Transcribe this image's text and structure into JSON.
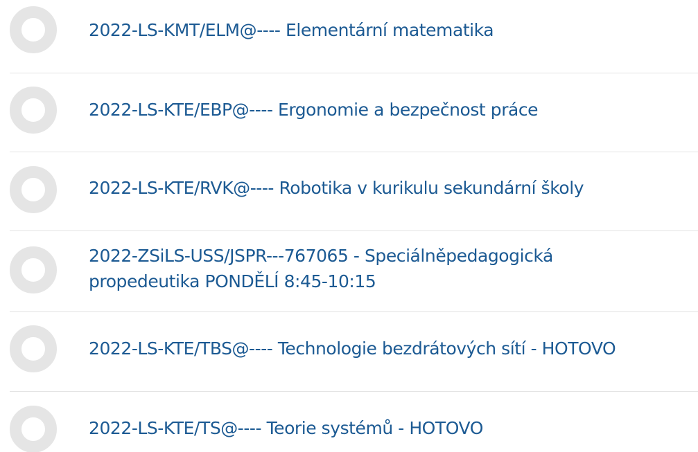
{
  "courses": [
    {
      "label": "2022-LS-KMT/ELM@---- Elementární matematika"
    },
    {
      "label": "2022-LS-KTE/EBP@---- Ergonomie a bezpečnost práce"
    },
    {
      "label": "2022-LS-KTE/RVK@---- Robotika v kurikulu sekundární školy"
    },
    {
      "label_line1": "2022-ZSiLS-USS/JSPR---767065 - Speciálněpedagogická",
      "label_line2": "propedeutika PONDĚLÍ 8:45-10:15"
    },
    {
      "label": "2022-LS-KTE/TBS@---- Technologie bezdrátových sítí - HOTOVO"
    },
    {
      "label": "2022-LS-KTE/TS@---- Teorie systémů - HOTOVO"
    }
  ]
}
